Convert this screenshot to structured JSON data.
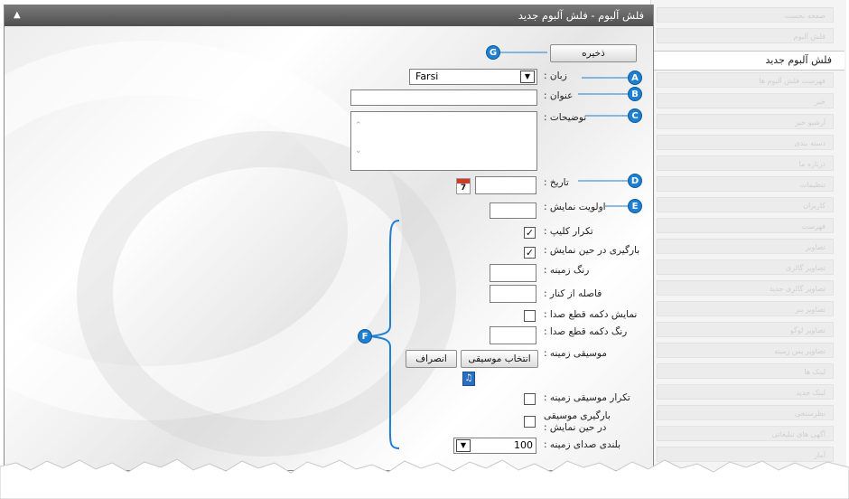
{
  "window": {
    "title": "فلش آلبوم - فلش آلبوم جدید"
  },
  "sidebar": {
    "items": [
      "صفحه نخست",
      "فلش آلبوم",
      "فلش آلبوم جدید",
      "فهرست فلش آلبوم ها",
      "خبر",
      "آرشیو خبر",
      "دسته بندی",
      "درباره ما",
      "تنظیمات",
      "کاربران",
      "فهرست",
      "تصاویر",
      "تصاویر گالری",
      "تصاویر گالری جدید",
      "تصاویر بنر",
      "تصاویر لوگو",
      "تصاویر پس زمینه",
      "لینک ها",
      "لینک جدید",
      "نظرسنجی",
      "آگهی های تبلیغاتی",
      "آمار"
    ],
    "active_index": 2
  },
  "form": {
    "save_label": "ذخیره",
    "language_label": "زبان :",
    "language_value": "Farsi",
    "title_label": "عنوان :",
    "description_label": "توضیحات :",
    "date_label": "تاریخ :",
    "calendar_day": "7",
    "priority_label": "اولویت نمایش :",
    "clip_repeat_label": "تکرار کلیپ :",
    "clip_repeat_checked": true,
    "load_while_display_label": "بارگیری در حین نمایش :",
    "load_while_display_checked": true,
    "bg_color_label": "رنگ زمینه :",
    "margin_label": "فاصله از کنار :",
    "show_mute_button_label": "نمایش دکمه قطع صدا :",
    "show_mute_button_checked": false,
    "mute_button_color_label": "رنگ دکمه قطع صدا :",
    "bg_music_label": "موسیقی زمینه :",
    "select_music_label": "انتخاب موسیقی",
    "cancel_label": "انصراف",
    "music_icon": "♫",
    "bg_music_repeat_label": "تکرار موسیقی زمینه :",
    "bg_music_repeat_checked": false,
    "load_music_label_line1": "بارگیری موسیقی",
    "load_music_label_line2": "در حین نمایش :",
    "load_music_checked": false,
    "bg_volume_label": "بلندی صدای زمینه :",
    "bg_volume_value": "100",
    "check_mark": "✓"
  },
  "callouts": {
    "A": "A",
    "B": "B",
    "C": "C",
    "D": "D",
    "E": "E",
    "F": "F",
    "G": "G"
  },
  "colors": {
    "callout": "#1f7fd1",
    "titlebar": "#5e5e5e"
  }
}
